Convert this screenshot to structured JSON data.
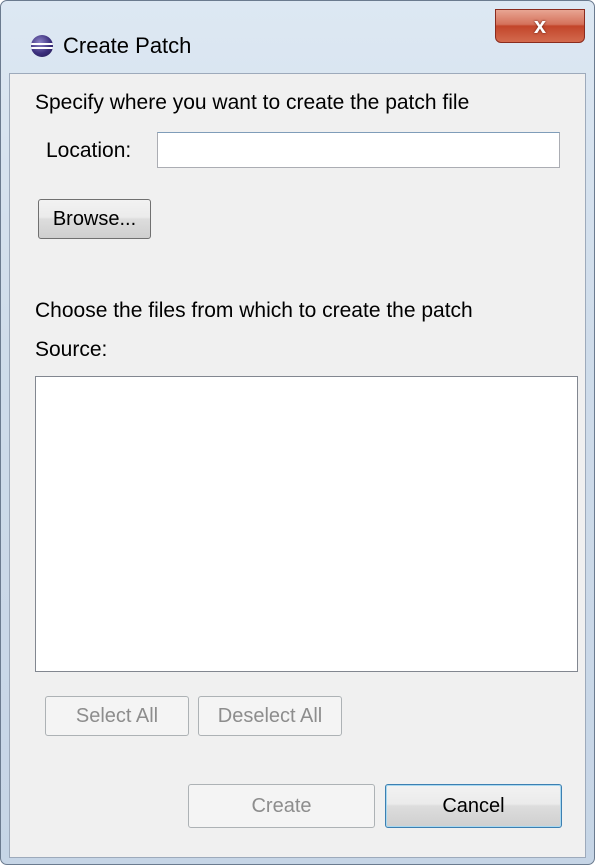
{
  "window": {
    "title": "Create Patch",
    "close_label": "x",
    "app_icon": "eclipse-icon"
  },
  "location_section": {
    "instruction": "Specify where you want to create the patch file",
    "location_label": "Location:",
    "location_value": "",
    "location_placeholder": "",
    "browse_label": "Browse..."
  },
  "source_section": {
    "instruction": "Choose the files from which to create the patch",
    "source_label": "Source:",
    "items": []
  },
  "selection_buttons": {
    "select_all_label": "Select All",
    "deselect_all_label": "Deselect All"
  },
  "footer": {
    "create_label": "Create",
    "cancel_label": "Cancel"
  }
}
